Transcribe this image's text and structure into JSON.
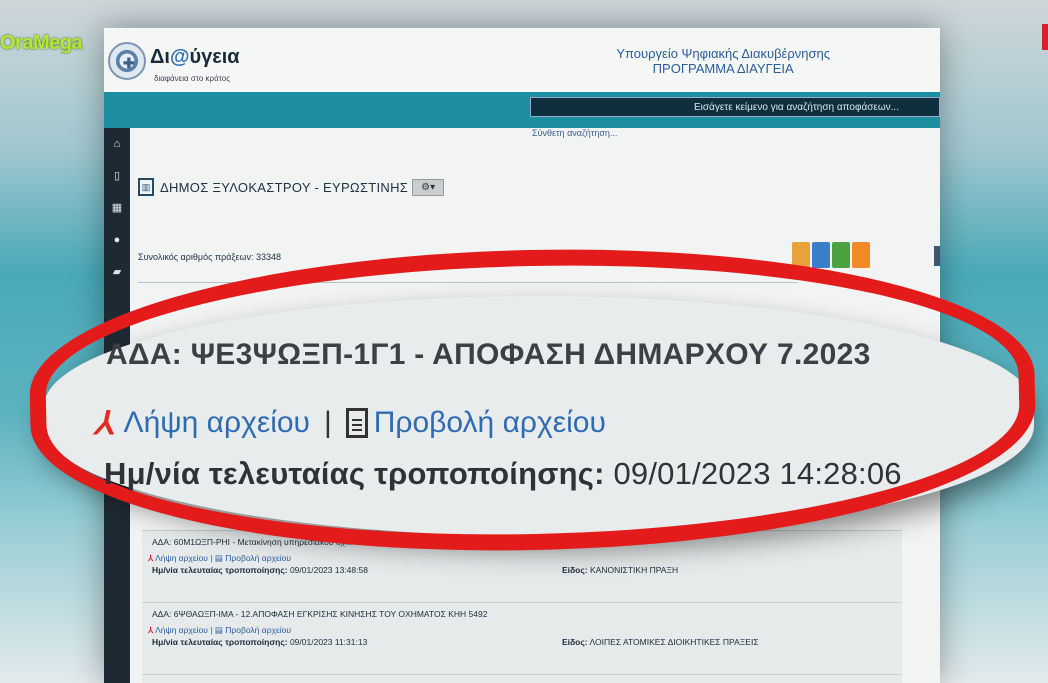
{
  "channel": {
    "logo": "OraMega"
  },
  "header": {
    "logo_title_pre": "Δι",
    "logo_title_at": "@",
    "logo_title_post": "ύγεια",
    "logo_tagline": "διαφάνεια στο κράτος",
    "ministry_line1": "Υπουργείο Ψηφιακής Διακυβέρνησης",
    "ministry_line2": "ΠΡΟΓΡΑΜΜΑ ΔΙΑΥΓΕΙΑ"
  },
  "search": {
    "placeholder": "Εισάγετε κείμενο για αναζήτηση αποφάσεων...",
    "advanced_link": "Σύνθετη αναζήτηση..."
  },
  "sidebar": {
    "icons": [
      "home-icon",
      "bookmark-icon",
      "grid-icon",
      "globe-icon",
      "chat-icon"
    ]
  },
  "org": {
    "name": "ΔΗΜΟΣ ΞΥΛΟΚΑΣΤΡΟΥ - ΕΥΡΩΣΤΙΝΗΣ",
    "gear_label": "⚙▾"
  },
  "summary": {
    "total_label": "Συνολικός αριθμός πράξεων: 33348"
  },
  "callout": {
    "title": "ΑΔΑ: ΨΕ3ΨΩΞΠ-1Γ1 - ΑΠΟΦΑΣΗ ΔΗΜΑΡΧΟΥ 7.2023",
    "download_label": "Λήψη αρχείου",
    "separator": "|",
    "view_label": "Προβολή αρχείου",
    "modified_label": "Ημ/νία τελευταίας τροποποίησης:",
    "modified_value": "09/01/2023 14:28:06"
  },
  "list": [
    {
      "title": "ΑΔΑ: 60Μ1ΩΞΠ-ΡΗΙ - Μετακίνηση υπηρεσιακού οχ...",
      "download": "Λήψη αρχείου",
      "view": "Προβολή αρχείου",
      "date_label": "Ημ/νία τελευταίας τροποποίησης:",
      "date_value": "09/01/2023 13:48:58",
      "type_label": "Είδος:",
      "type_value": "ΚΑΝΟΝΙΣΤΙΚΗ ΠΡΑΞΗ"
    },
    {
      "title": "ΑΔΑ: 6ΨΘΑΩΞΠ-ΙΜΑ - 12.ΑΠΟΦΑΣΗ ΕΓΚΡΙΣΗΣ ΚΙΝΗΣΗΣ ΤΟΥ ΟΧΗΜΑΤΟΣ ΚΗΗ 5492",
      "download": "Λήψη αρχείου",
      "view": "Προβολή αρχείου",
      "date_label": "Ημ/νία τελευταίας τροποποίησης:",
      "date_value": "09/01/2023 11:31:13",
      "type_label": "Είδος:",
      "type_value": "ΛΟΙΠΕΣ ΑΤΟΜΙΚΕΣ ΔΙΟΙΚΗΤΙΚΕΣ ΠΡΑΞΕΙΣ"
    }
  ],
  "colors": {
    "accent": "#1d8fa0",
    "highlight": "#e31b1b",
    "link": "#2f6bb3"
  }
}
